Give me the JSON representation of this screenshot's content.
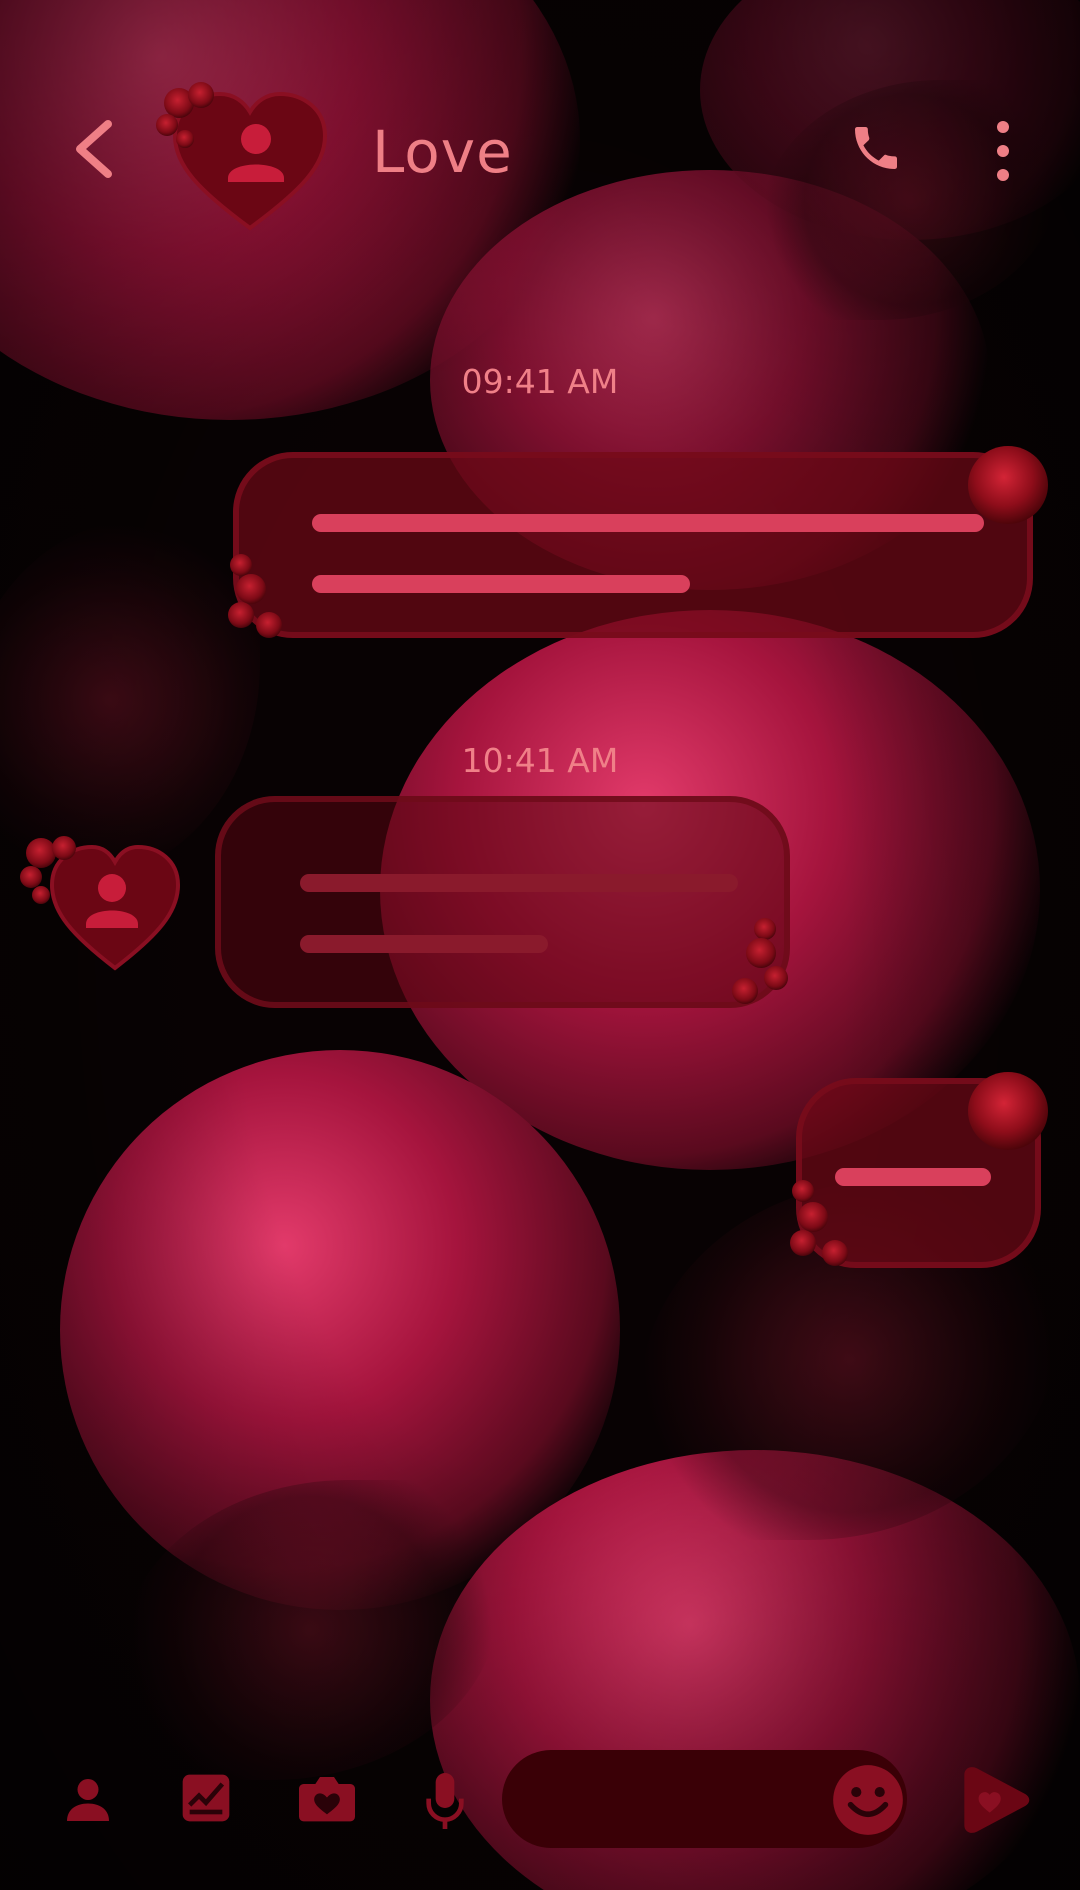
{
  "header": {
    "contact_name": "Love",
    "back_icon": "chevron-left-icon",
    "call_icon": "phone-icon",
    "menu_icon": "more-vertical-icon"
  },
  "messages": [
    {
      "timestamp": "09:41 AM",
      "direction": "outgoing"
    },
    {
      "timestamp": "10:41 AM",
      "direction": "incoming"
    },
    {
      "timestamp": "",
      "direction": "outgoing"
    }
  ],
  "composer": {
    "placeholder": "",
    "icons": [
      "contact-icon",
      "gallery-icon",
      "camera-icon",
      "mic-icon",
      "emoji-icon",
      "send-heart-icon"
    ]
  },
  "colors": {
    "accent": "#ef7f86",
    "bubble_line_out": "#d9405c",
    "bubble_line_in": "#8a1a2c",
    "input_bg": "#3a0006",
    "icon_dark": "#8a0f22"
  }
}
